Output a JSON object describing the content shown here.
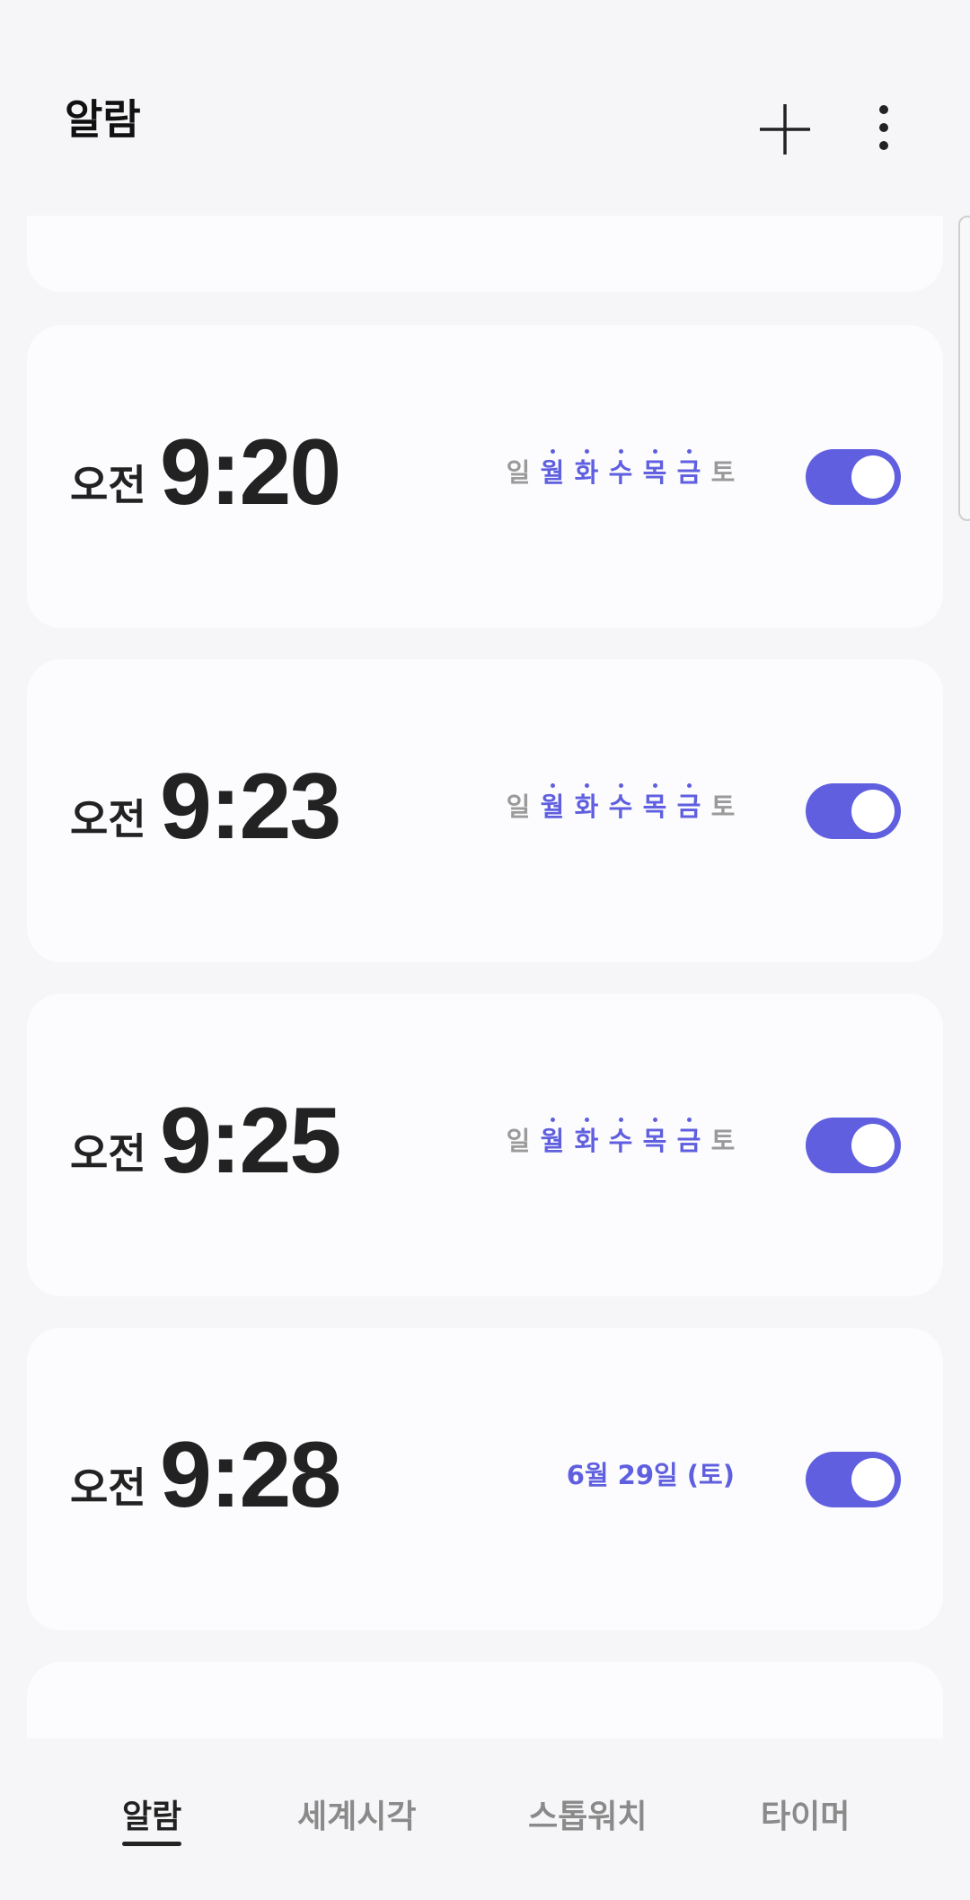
{
  "header": {
    "title": "알람"
  },
  "alarms": [
    {
      "ampm": "오전",
      "time": "9:20",
      "days": [
        {
          "label": "일",
          "active": false
        },
        {
          "label": "월",
          "active": true
        },
        {
          "label": "화",
          "active": true
        },
        {
          "label": "수",
          "active": true
        },
        {
          "label": "목",
          "active": true
        },
        {
          "label": "금",
          "active": true
        },
        {
          "label": "토",
          "active": false
        }
      ],
      "enabled": true
    },
    {
      "ampm": "오전",
      "time": "9:23",
      "days": [
        {
          "label": "일",
          "active": false
        },
        {
          "label": "월",
          "active": true
        },
        {
          "label": "화",
          "active": true
        },
        {
          "label": "수",
          "active": true
        },
        {
          "label": "목",
          "active": true
        },
        {
          "label": "금",
          "active": true
        },
        {
          "label": "토",
          "active": false
        }
      ],
      "enabled": true
    },
    {
      "ampm": "오전",
      "time": "9:25",
      "days": [
        {
          "label": "일",
          "active": false
        },
        {
          "label": "월",
          "active": true
        },
        {
          "label": "화",
          "active": true
        },
        {
          "label": "수",
          "active": true
        },
        {
          "label": "목",
          "active": true
        },
        {
          "label": "금",
          "active": true
        },
        {
          "label": "토",
          "active": false
        }
      ],
      "enabled": true
    },
    {
      "ampm": "오전",
      "time": "9:28",
      "date": "6월 29일 (토)",
      "enabled": true
    }
  ],
  "nav": {
    "tabs": [
      {
        "label": "알람",
        "active": true
      },
      {
        "label": "세계시각",
        "active": false
      },
      {
        "label": "스톱워치",
        "active": false
      },
      {
        "label": "타이머",
        "active": false
      }
    ]
  },
  "colors": {
    "accent": "#5f5fe0",
    "background": "#f6f6f8",
    "card": "#fcfcfe",
    "inactive_day": "#9a9a9a"
  }
}
